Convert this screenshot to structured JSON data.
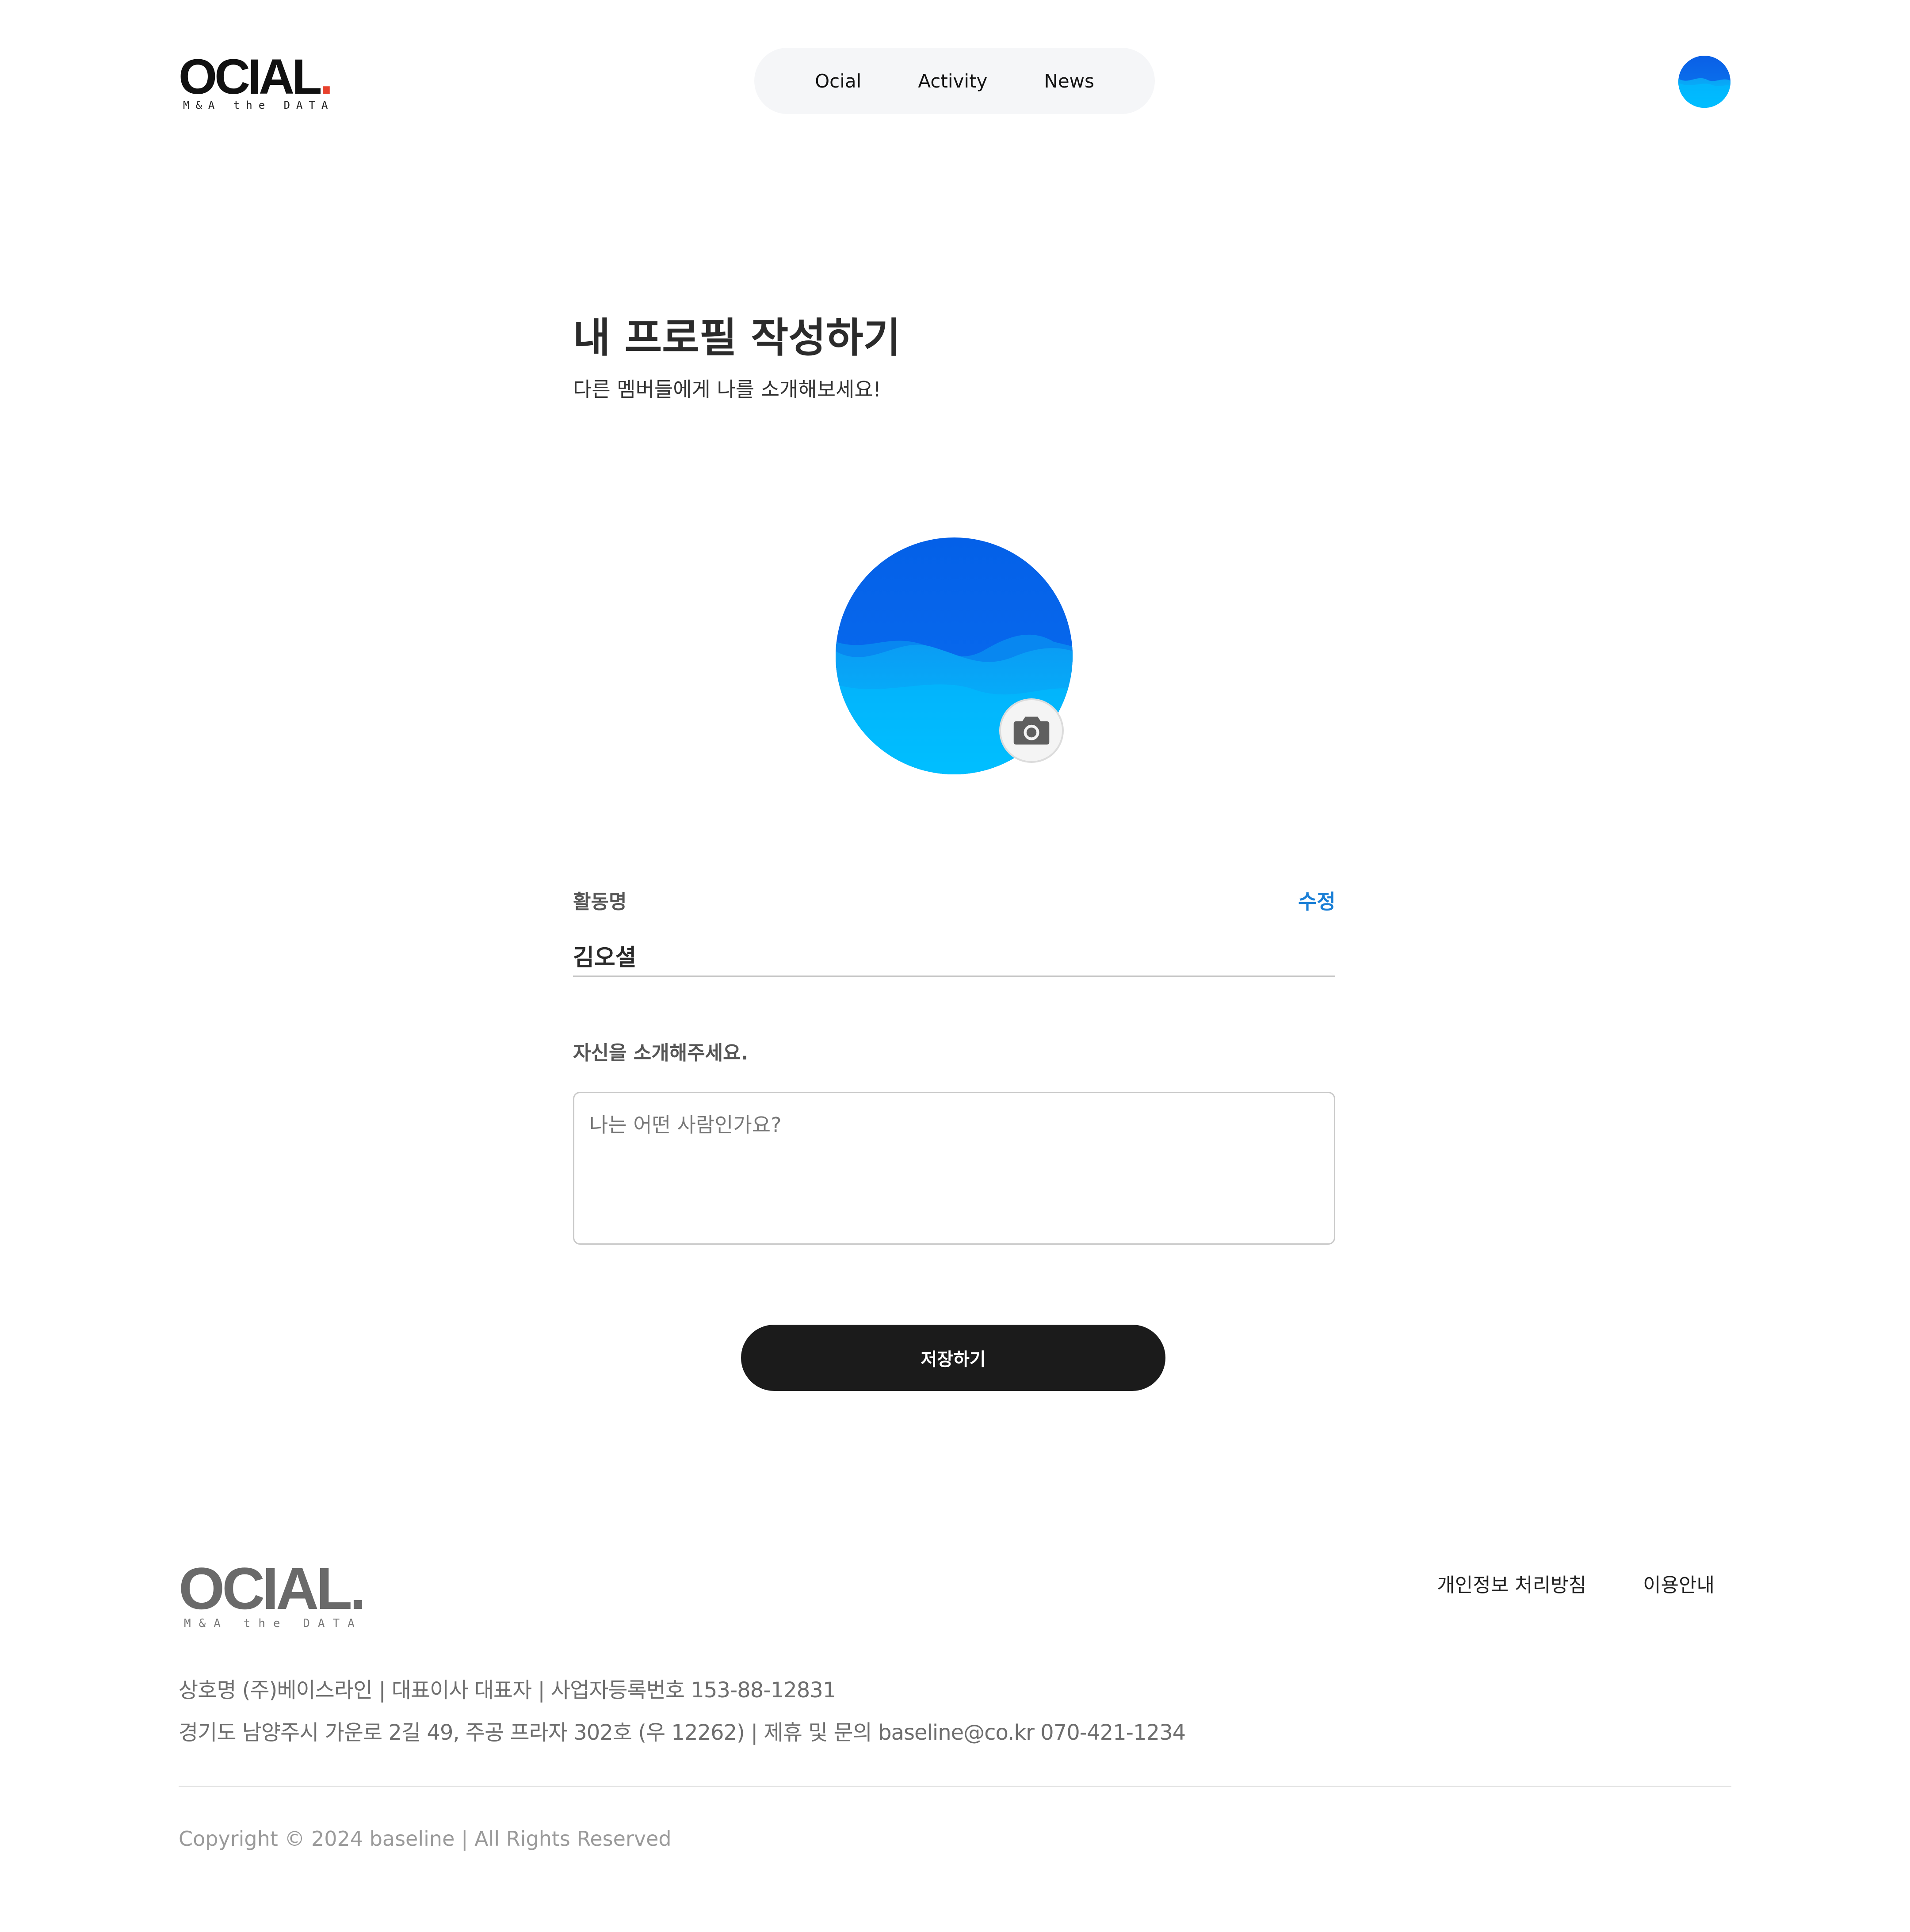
{
  "header": {
    "logo_word": "OCIAL",
    "logo_dot": ".",
    "logo_tagline": "M&A the DATA",
    "nav": [
      "Ocial",
      "Activity",
      "News"
    ]
  },
  "page": {
    "title": "내 프로필 작성하기",
    "subtitle": "다른 멤버들에게 나를 소개해보세요!"
  },
  "profile": {
    "nickname_label": "활동명",
    "edit_label": "수정",
    "nickname_value": "김오셜",
    "intro_label": "자신을 소개해주세요.",
    "intro_placeholder": "나는 어떤 사람인가요?",
    "save_label": "저장하기"
  },
  "footer": {
    "logo_word": "OCIAL",
    "logo_dot": ".",
    "logo_tagline": "M&A the DATA",
    "links": [
      "개인정보 처리방침",
      "이용안내"
    ],
    "company_line1": "상호명 (주)베이스라인  |  대표이사 대표자  |  사업자등록번호 153-88-12831",
    "company_line2": "경기도 남양주시 가운로 2길 49, 주공 프라자 302호 (우 12262)  |  제휴 및 문의 baseline@co.kr  070-421-1234",
    "copyright": "Copyright © 2024 baseline | All Rights Reserved"
  },
  "colors": {
    "accent_blue": "#1a7fd6",
    "logo_dot": "#e8412c",
    "button_dark": "#1b1b1b",
    "wave_dark": "#0a66e8",
    "wave_light": "#00bfff"
  },
  "icons": [
    "wave-avatar-icon",
    "camera-icon"
  ]
}
